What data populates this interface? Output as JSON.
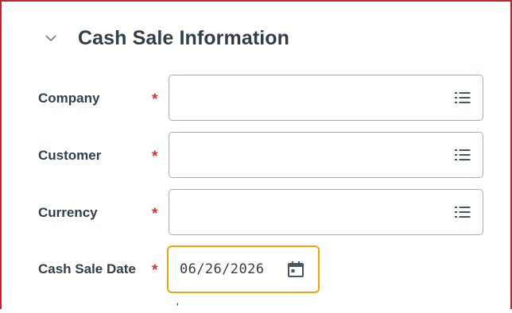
{
  "section": {
    "title": "Cash Sale Information",
    "expanded": true
  },
  "fields": [
    {
      "label": "Company",
      "required_mark": "*",
      "value": "",
      "icon": "list-icon"
    },
    {
      "label": "Customer",
      "required_mark": "*",
      "value": "",
      "icon": "list-icon"
    },
    {
      "label": "Currency",
      "required_mark": "*",
      "value": "",
      "icon": "list-icon"
    }
  ],
  "date_field": {
    "label": "Cash Sale Date",
    "required_mark": "*",
    "value": "06/26/2026",
    "icon": "calendar-icon"
  },
  "colors": {
    "border_accent": "#c0262d",
    "required": "#d0312d",
    "focus": "#f0a30a",
    "text": "#333d47",
    "field_border": "#a6acb2"
  }
}
